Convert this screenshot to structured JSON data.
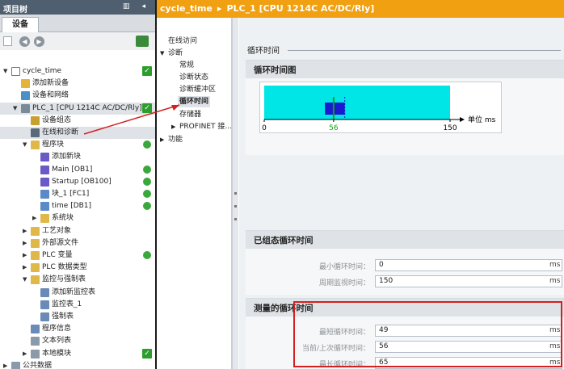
{
  "tree": {
    "title": "项目树",
    "tab": "设备",
    "items": [
      {
        "label": "cycle_time",
        "status": "check"
      },
      {
        "label": "添加新设备"
      },
      {
        "label": "设备和网络"
      },
      {
        "label": "PLC_1 [CPU 1214C AC/DC/Rly]",
        "status": "check"
      },
      {
        "label": "设备组态"
      },
      {
        "label": "在线和诊断"
      },
      {
        "label": "程序块",
        "status": "dot"
      },
      {
        "label": "添加新块"
      },
      {
        "label": "Main [OB1]",
        "status": "dot"
      },
      {
        "label": "Startup [OB100]",
        "status": "dot"
      },
      {
        "label": "块_1 [FC1]",
        "status": "dot"
      },
      {
        "label": "time [DB1]",
        "status": "dot"
      },
      {
        "label": "系统块"
      },
      {
        "label": "工艺对象"
      },
      {
        "label": "外部源文件"
      },
      {
        "label": "PLC 变量",
        "status": "dot"
      },
      {
        "label": "PLC 数据类型"
      },
      {
        "label": "监控与强制表"
      },
      {
        "label": "添加新监控表"
      },
      {
        "label": "监控表_1"
      },
      {
        "label": "强制表"
      },
      {
        "label": "程序信息"
      },
      {
        "label": "文本列表"
      },
      {
        "label": "本地模块",
        "status": "check"
      },
      {
        "label": "公共数据"
      }
    ]
  },
  "header": {
    "project": "cycle_time",
    "device": "PLC_1 [CPU 1214C AC/DC/Rly]",
    "separator": "▸"
  },
  "nav": {
    "items": [
      "在线访问",
      "诊断",
      "常规",
      "诊断状态",
      "诊断缓冲区",
      "循环时间",
      "存储器",
      "PROFINET 接...",
      "功能"
    ]
  },
  "main": {
    "title": "循环时间",
    "chart_section_title": "循环时间图",
    "config_section_title": "已组态循环时间",
    "measured_section_title": "测量的循环时间",
    "unit": "ms",
    "config_fields": [
      {
        "label": "最小循环时间：",
        "value": "0",
        "unit": "ms"
      },
      {
        "label": "周期监视时间：",
        "value": "150",
        "unit": "ms"
      }
    ],
    "measured_fields": [
      {
        "label": "最短循环时间：",
        "value": "49",
        "unit": "ms"
      },
      {
        "label": "当前/上次循环时间：",
        "value": "56",
        "unit": "ms"
      },
      {
        "label": "最长循环时间：",
        "value": "65",
        "unit": "ms"
      }
    ]
  },
  "chart_data": {
    "type": "bar",
    "xlabel": "单位 ms",
    "xlim": [
      0,
      150
    ],
    "x_ticks": [
      "0",
      "56",
      "150"
    ],
    "configured_min_ms": 0,
    "watchdog_ms": 150,
    "measured_min_ms": 49,
    "measured_current_ms": 56,
    "measured_max_ms": 65,
    "colors": {
      "range": "#00e5e5",
      "measured": "#1a1ad0",
      "current_marker": "#10a010",
      "max_marker": "#1a1ad0"
    }
  },
  "colors": {
    "header": "#f0a010",
    "highlight": "#d42020",
    "titlebar": "#4f5f6f"
  }
}
